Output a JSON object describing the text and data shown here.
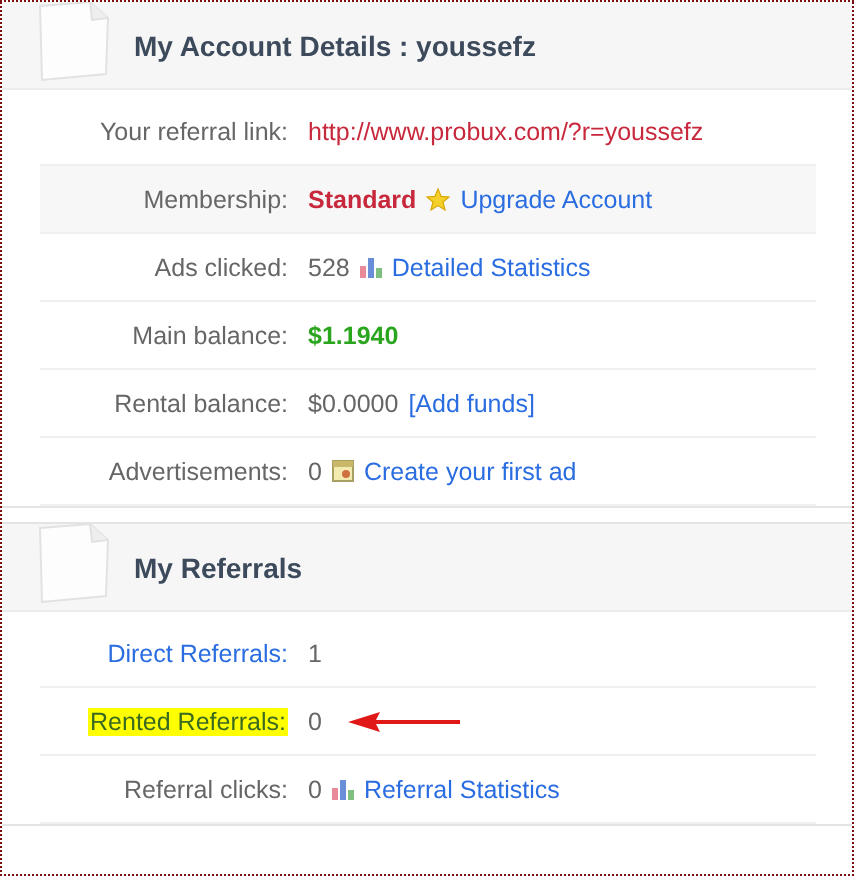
{
  "sections": [
    {
      "title": "My Account Details : youssefz",
      "rows": [
        {
          "label": "Your referral link:",
          "kind": "plain",
          "shaded": false,
          "pointer": false,
          "values": [
            {
              "kind": "red",
              "text": "http://www.probux.com/?r=youssefz"
            }
          ]
        },
        {
          "label": "Membership:",
          "kind": "plain",
          "shaded": true,
          "pointer": false,
          "values": [
            {
              "kind": "red-bold",
              "text": "Standard"
            },
            {
              "kind": "star-link",
              "text": "Upgrade Account"
            }
          ]
        },
        {
          "label": "Ads clicked:",
          "kind": "plain",
          "shaded": false,
          "pointer": false,
          "values": [
            {
              "kind": "plain",
              "text": "528"
            },
            {
              "kind": "chart-link",
              "text": "Detailed Statistics"
            }
          ]
        },
        {
          "label": "Main balance:",
          "kind": "plain",
          "shaded": false,
          "pointer": false,
          "values": [
            {
              "kind": "green-bold",
              "text": "$1.1940"
            }
          ]
        },
        {
          "label": "Rental balance:",
          "kind": "plain",
          "shaded": false,
          "pointer": false,
          "values": [
            {
              "kind": "plain",
              "text": "$0.0000"
            },
            {
              "kind": "link",
              "text": "[Add funds]"
            }
          ]
        },
        {
          "label": "Advertisements:",
          "kind": "plain",
          "shaded": false,
          "pointer": false,
          "values": [
            {
              "kind": "plain",
              "text": "0"
            },
            {
              "kind": "ad-link",
              "text": "Create your first ad"
            }
          ]
        }
      ]
    },
    {
      "title": "My Referrals",
      "rows": [
        {
          "label": "Direct Referrals:",
          "kind": "link",
          "shaded": false,
          "pointer": false,
          "values": [
            {
              "kind": "plain",
              "text": "1"
            }
          ]
        },
        {
          "label": "Rented Referrals:",
          "kind": "highlighted",
          "shaded": false,
          "pointer": true,
          "values": [
            {
              "kind": "plain",
              "text": "0"
            }
          ]
        },
        {
          "label": "Referral clicks:",
          "kind": "plain",
          "shaded": false,
          "pointer": false,
          "values": [
            {
              "kind": "plain",
              "text": "0"
            },
            {
              "kind": "chart-link",
              "text": "Referral Statistics"
            }
          ]
        }
      ]
    }
  ]
}
